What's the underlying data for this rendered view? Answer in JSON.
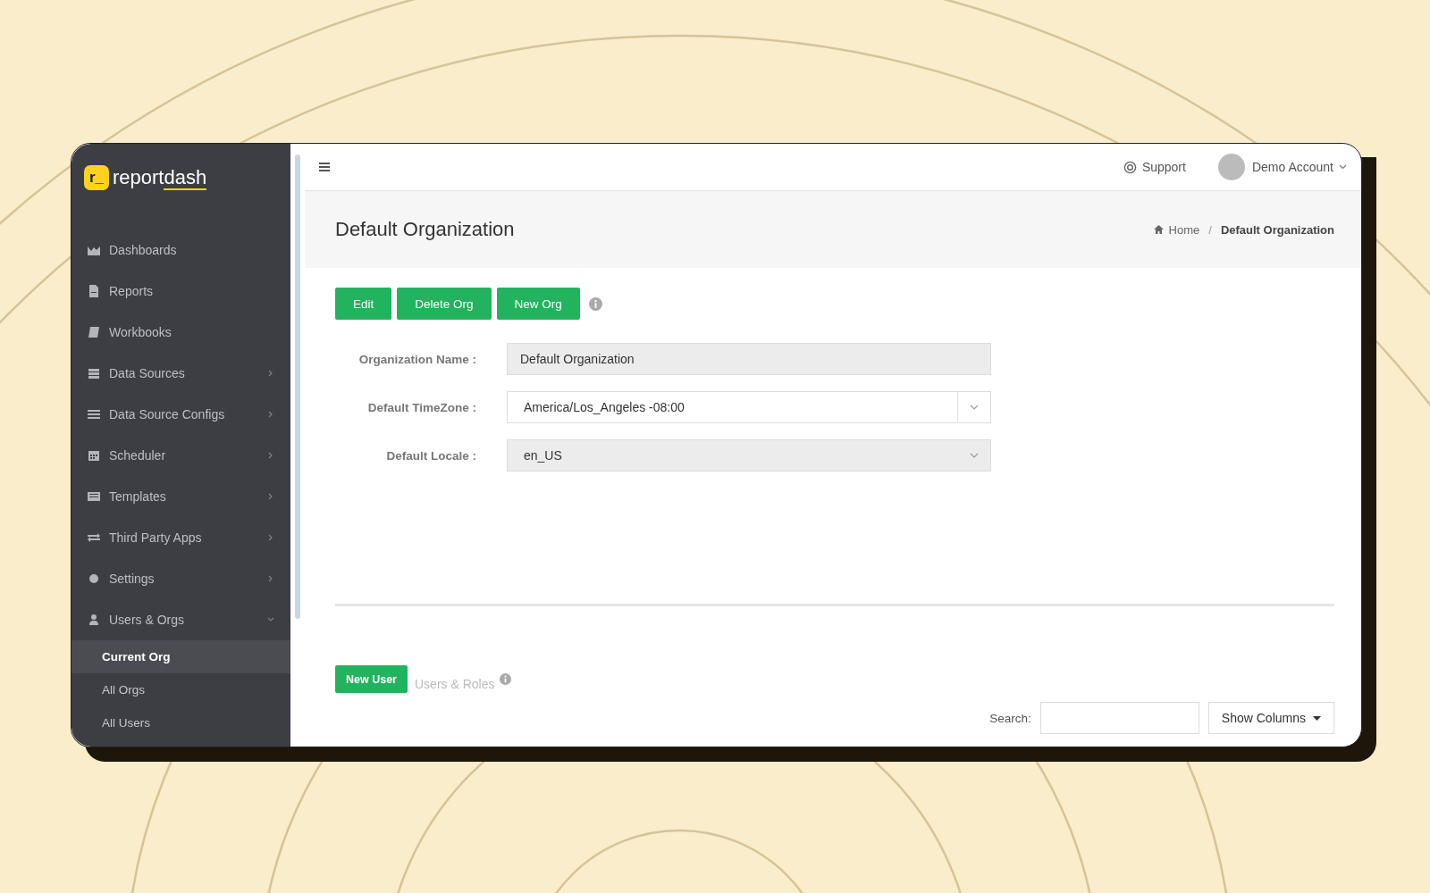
{
  "logo": {
    "mark": "r_",
    "name_parts": [
      "report",
      "dash"
    ]
  },
  "sidebar": {
    "items": [
      {
        "label": "Dashboards",
        "has_submenu": false
      },
      {
        "label": "Reports",
        "has_submenu": false
      },
      {
        "label": "Workbooks",
        "has_submenu": false
      },
      {
        "label": "Data Sources",
        "has_submenu": true
      },
      {
        "label": "Data Source Configs",
        "has_submenu": true
      },
      {
        "label": "Scheduler",
        "has_submenu": true
      },
      {
        "label": "Templates",
        "has_submenu": true
      },
      {
        "label": "Third Party Apps",
        "has_submenu": true
      },
      {
        "label": "Settings",
        "has_submenu": true
      },
      {
        "label": "Users & Orgs",
        "has_submenu": true,
        "expanded": true,
        "children": [
          {
            "label": "Current Org",
            "selected": true
          },
          {
            "label": "All Orgs",
            "selected": false
          },
          {
            "label": "All Users",
            "selected": false
          }
        ]
      }
    ]
  },
  "topbar": {
    "support": "Support",
    "account": "Demo Account"
  },
  "header": {
    "title": "Default Organization",
    "breadcrumb": [
      "Home",
      "Default Organization"
    ],
    "breadcrumb_separator": "/"
  },
  "actions": [
    "Edit",
    "Delete Org",
    "New Org"
  ],
  "form": [
    {
      "label": "Organization Name :",
      "kind": "text",
      "value": "Default Organization",
      "disabled": true
    },
    {
      "label": "Default TimeZone :",
      "kind": "select",
      "value": "America/Los_Angeles -08:00",
      "disabled": false
    },
    {
      "label": "Default Locale :",
      "kind": "select",
      "value": "en_US",
      "disabled": true
    }
  ],
  "users": {
    "button": "New User",
    "heading": "Users & Roles",
    "search_label": "Search:",
    "show_columns": "Show Columns"
  }
}
